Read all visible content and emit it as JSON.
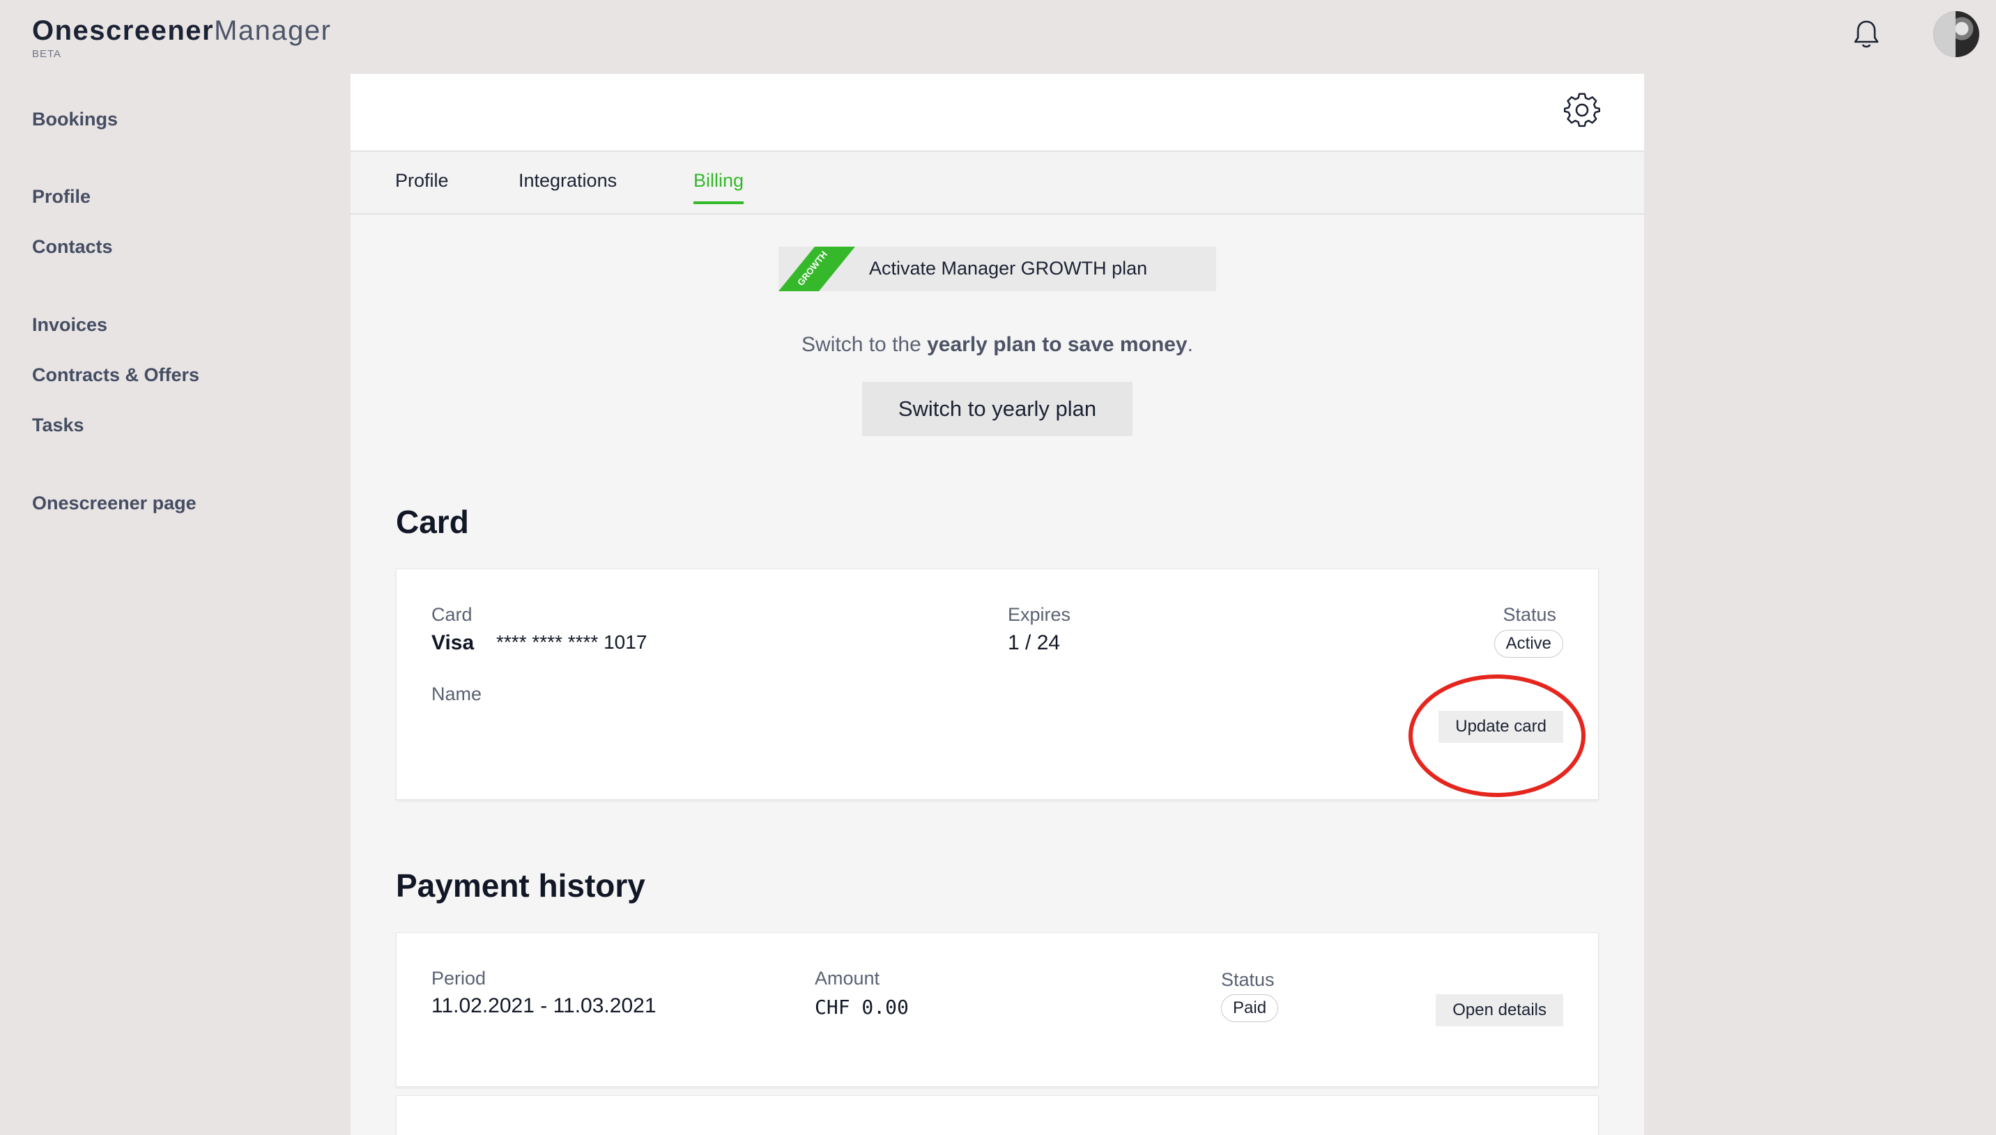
{
  "app": {
    "brand_main": "Onescreener",
    "brand_sub": "Manager",
    "brand_beta": "BETA"
  },
  "sidebar": {
    "items": [
      {
        "label": "Bookings"
      },
      {
        "label": "Profile"
      },
      {
        "label": "Contacts"
      },
      {
        "label": "Invoices"
      },
      {
        "label": "Contracts & Offers"
      },
      {
        "label": "Tasks"
      },
      {
        "label": "Onescreener page"
      }
    ]
  },
  "tabs": [
    {
      "label": "Profile"
    },
    {
      "label": "Integrations"
    },
    {
      "label": "Billing"
    }
  ],
  "billing": {
    "growth_ribbon": "GROWTH",
    "growth_label": "Activate Manager GROWTH plan",
    "save_prefix": "Switch to the ",
    "save_bold": "yearly plan to save money",
    "save_suffix": ".",
    "yearly_button": "Switch to yearly plan"
  },
  "card_section": {
    "title": "Card",
    "card_label": "Card",
    "card_brand": "Visa",
    "card_number": "**** **** **** 1017",
    "expires_label": "Expires",
    "expires_value": "1 / 24",
    "status_label": "Status",
    "status_value": "Active",
    "name_label": "Name",
    "update_button": "Update card"
  },
  "payment_history": {
    "title": "Payment history",
    "rows": [
      {
        "period_label": "Period",
        "period_value": "11.02.2021 - 11.03.2021",
        "amount_label": "Amount",
        "amount_value": "CHF 0.00",
        "status_label": "Status",
        "status_value": "Paid",
        "details_button": "Open details"
      }
    ]
  },
  "colors": {
    "accent": "#35b92b",
    "annotation": "#e5261e"
  },
  "icons": {
    "notifications": "bell-icon",
    "settings": "gear-icon"
  }
}
